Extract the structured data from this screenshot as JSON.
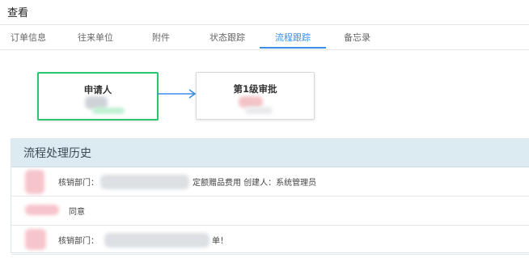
{
  "window": {
    "title": "查看"
  },
  "tabs": [
    {
      "label": "订单信息"
    },
    {
      "label": "往来单位"
    },
    {
      "label": "附件"
    },
    {
      "label": "状态跟踪"
    },
    {
      "label": "流程跟踪",
      "active": true
    },
    {
      "label": "备忘录"
    }
  ],
  "flow": {
    "nodes": [
      {
        "label": "申请人"
      },
      {
        "label": "第1级审批"
      }
    ]
  },
  "history": {
    "title": "流程处理历史",
    "rows": [
      {
        "text_left": "核销部门：",
        "text_right": "定额赠品费用 创建人：系统管理员"
      },
      {
        "text_left": "同意"
      },
      {
        "text_left": "核销部门：",
        "text_right": "单！"
      }
    ]
  },
  "colors": {
    "accent": "#3a8ee6",
    "active_node_border": "#2ec46b",
    "panel_header_bg": "#dceaf2"
  }
}
